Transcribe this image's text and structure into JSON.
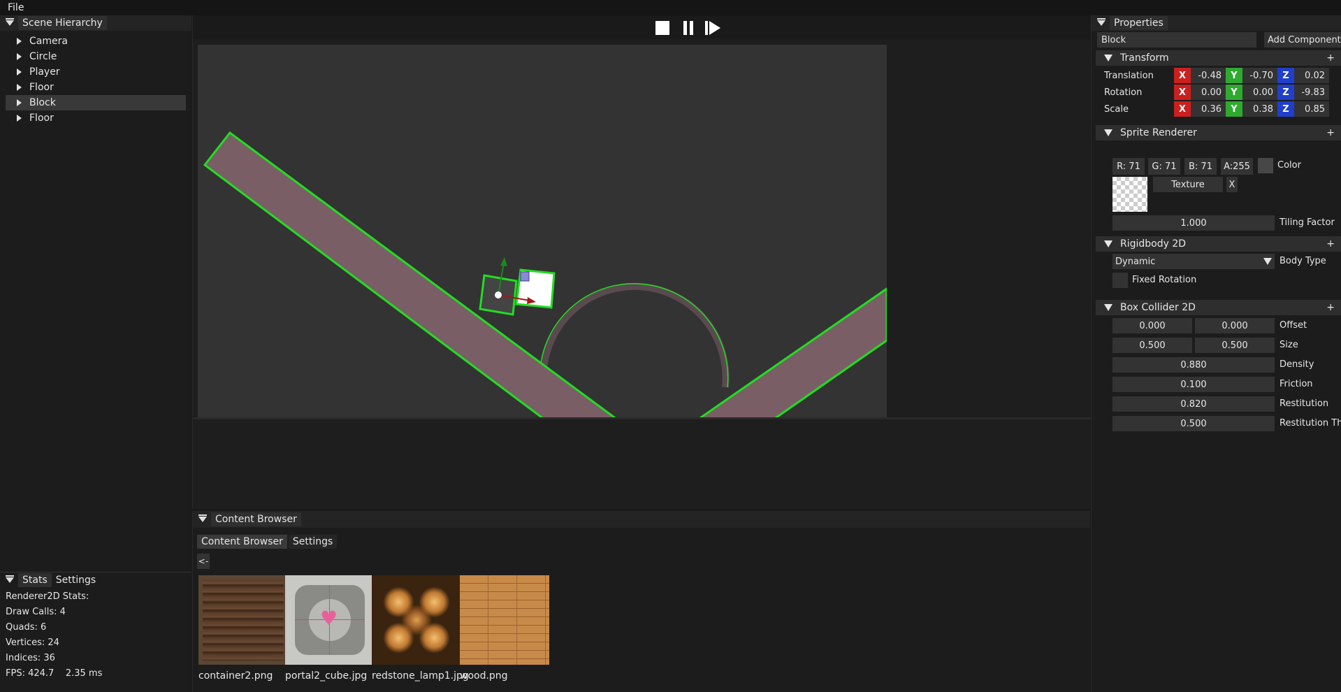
{
  "menubar": {
    "file": "File"
  },
  "hierarchy": {
    "title": "Scene Hierarchy",
    "items": [
      {
        "label": "Camera"
      },
      {
        "label": "Circle"
      },
      {
        "label": "Player"
      },
      {
        "label": "Floor"
      },
      {
        "label": "Block"
      },
      {
        "label": "Floor"
      }
    ],
    "selected_index": 4
  },
  "stats": {
    "tabs": [
      "Stats",
      "Settings"
    ],
    "lines": [
      "Renderer2D Stats:",
      "Draw Calls: 4",
      "Quads: 6",
      "Vertices: 24",
      "Indices: 36",
      "FPS: 424.7    2.35 ms"
    ]
  },
  "toolbar": {
    "buttons": [
      "stop-icon",
      "pause-icon",
      "step-icon"
    ]
  },
  "content_browser": {
    "title": "Content Browser",
    "tabs": [
      "Content Browser",
      "Settings"
    ],
    "back": "<-",
    "files": [
      {
        "name": "container2.png"
      },
      {
        "name": "portal2_cube.jpg"
      },
      {
        "name": "redstone_lamp1.jpg"
      },
      {
        "name": "wood.png"
      }
    ]
  },
  "properties": {
    "title": "Properties",
    "entity_name": "Block",
    "add_component": "Add Component",
    "transform": {
      "title": "Transform",
      "plus": "+",
      "rows": [
        {
          "label": "Translation",
          "x": "-0.48",
          "y": "-0.70",
          "z": "0.02"
        },
        {
          "label": "Rotation",
          "x": "0.00",
          "y": "0.00",
          "z": "-9.83"
        },
        {
          "label": "Scale",
          "x": "0.36",
          "y": "0.38",
          "z": "0.85"
        }
      ],
      "axis_x": "X",
      "axis_y": "Y",
      "axis_z": "Z"
    },
    "sprite": {
      "title": "Sprite Renderer",
      "plus": "+",
      "r": "R: 71",
      "g": "G: 71",
      "b": "B: 71",
      "a": "A:255",
      "color_label": "Color",
      "texture": "Texture",
      "texture_clear": "X",
      "tiling": "1.000",
      "tiling_label": "Tiling Factor"
    },
    "rigidbody": {
      "title": "Rigidbody 2D",
      "plus": "+",
      "body_type": "Dynamic",
      "body_type_label": "Body Type",
      "fixed_rotation": "Fixed Rotation"
    },
    "box_collider": {
      "title": "Box Collider 2D",
      "plus": "+",
      "offset_x": "0.000",
      "offset_y": "0.000",
      "offset_label": "Offset",
      "size_x": "0.500",
      "size_y": "0.500",
      "size_label": "Size",
      "density": "0.880",
      "density_label": "Density",
      "friction": "0.100",
      "friction_label": "Friction",
      "restitution": "0.820",
      "restitution_label": "Restitution",
      "restitution_thr": "0.500",
      "restitution_thr_label": "Restitution Thr"
    }
  },
  "colors": {
    "collider_outline": "#22dd22",
    "platform": "#7a5e66",
    "viewport_bg": "#333333"
  }
}
